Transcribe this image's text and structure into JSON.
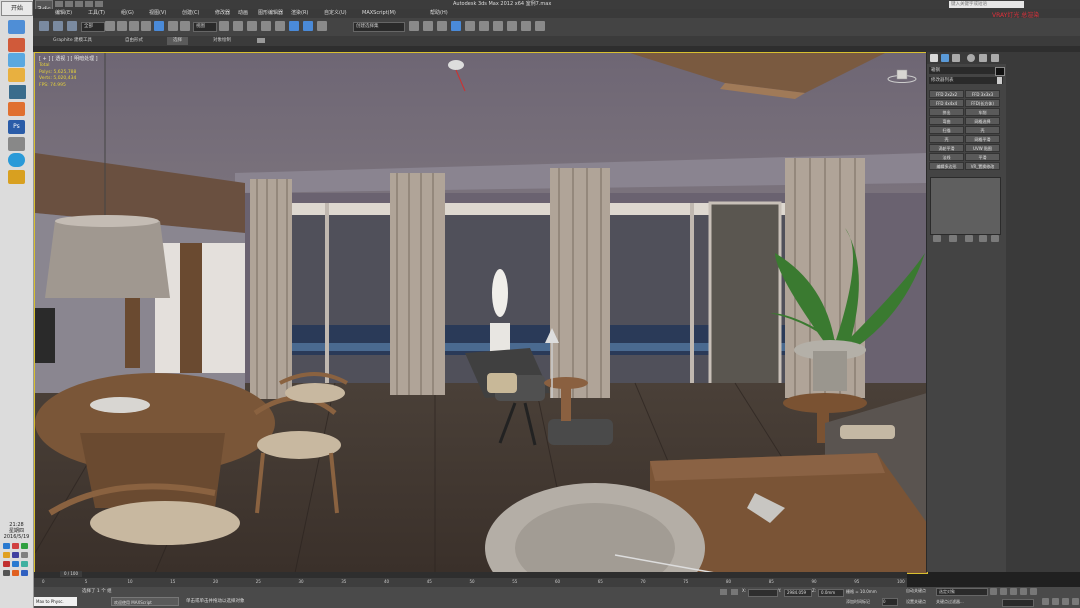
{
  "taskbar": {
    "start_label": "开始",
    "clock_time": "21:28",
    "clock_weekday": "星期四",
    "clock_date": "2016/5/19"
  },
  "window": {
    "app_icon": "3ds",
    "title": "Autodesk 3ds Max  2012 x64     室例7.max",
    "search_placeholder": "键入关键字或短语",
    "overlay_text": "VRAY灯光  总渲染"
  },
  "menus": [
    "编辑(E)",
    "工具(T)",
    "组(G)",
    "视图(V)",
    "创建(C)",
    "修改器",
    "动画",
    "图形编辑器",
    "渲染(R)",
    "自定义(U)",
    "MAXScript(M)",
    "帮助(H)"
  ],
  "toolbar": {
    "filter_dropdown": "全部",
    "view_dropdown": "视图",
    "selection_set_dropdown": "创建选择集"
  },
  "ribbon": {
    "tabs": [
      "Graphite 建模工具",
      "自由形式",
      "选择",
      "对象绘制"
    ],
    "active_tab": "选择"
  },
  "viewport": {
    "label": "[ + ] [ 透视 ] [ 明暗处理 ]",
    "stats": [
      "Total",
      "Polys: 5,625,788",
      "Verts: 5,020,434",
      "",
      "FPS:   74.995"
    ]
  },
  "command_panel": {
    "object_name": "箱钢",
    "modifier_list": "修改器列表",
    "buttons": [
      [
        "FFD 2x2x2",
        "FFD 3x3x3"
      ],
      [
        "FFD 4x4x4",
        "FFD(长方体)"
      ],
      [
        "挤出",
        "车削"
      ],
      [
        "弯曲",
        "网格选择"
      ],
      [
        "扫描",
        "壳"
      ],
      [
        "壳",
        "网格平滑"
      ],
      [
        "涡轮平滑",
        "UVW 贴图"
      ],
      [
        "法线",
        "平滑"
      ],
      [
        "编辑多边形",
        "VR_置换修改"
      ]
    ]
  },
  "timeline": {
    "frame_label": "0 / 100",
    "ticks": [
      "0",
      "5",
      "10",
      "15",
      "20",
      "25",
      "30",
      "35",
      "40",
      "45",
      "50",
      "55",
      "60",
      "65",
      "70",
      "75",
      "80",
      "85",
      "90",
      "95",
      "100"
    ]
  },
  "status": {
    "maxscript": "Max to Physc.",
    "selected": "选择了 1 个 组",
    "prompt": "单击或单击并拖动以选择对象",
    "task_item": "欢迎使用 MAXScript",
    "x_label": "X:",
    "x_value": "",
    "y_label": "Y:",
    "y_value": "2984.059",
    "z_label": "Z:",
    "z_value": "0.0mm",
    "grid": "栅格 = 10.0mm",
    "add_time_tag": "添加时间标记",
    "auto_key": "自动关键点",
    "selection_dropdown": "选定对象",
    "set_key": "设置关键点",
    "key_filters": "关键点过滤器...",
    "frame_count": "0"
  },
  "colors": {
    "accent_yellow": "#e6d23a",
    "viewport_border": "#d8c030",
    "search_overlay": "#e0303a"
  }
}
